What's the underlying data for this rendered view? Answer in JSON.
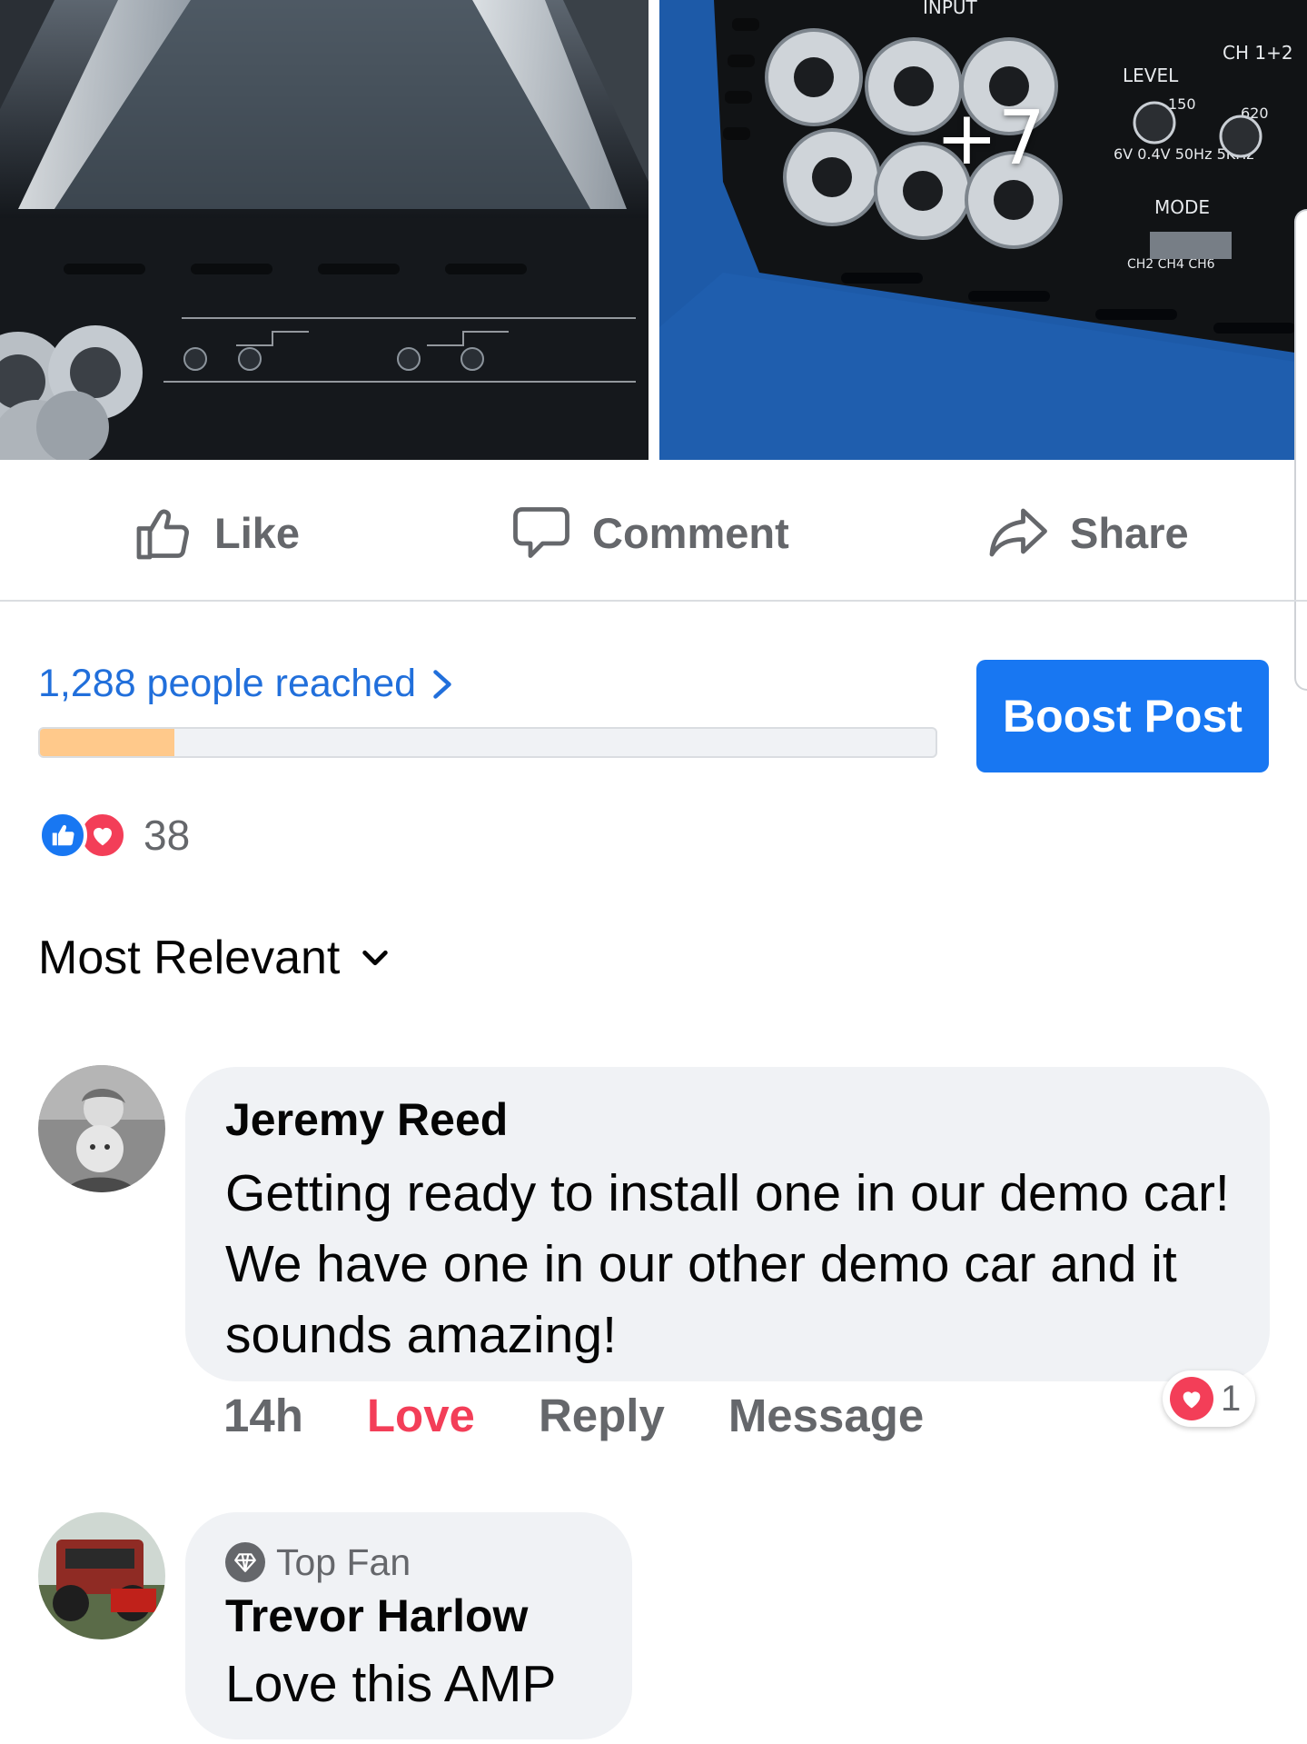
{
  "photos": {
    "more_count": "+7",
    "left_photo": "amplifier heatsink and controls",
    "right_photo": "amplifier input jacks and level controls"
  },
  "actions": {
    "like": "Like",
    "comment": "Comment",
    "share": "Share"
  },
  "insights": {
    "reach_label": "1,288 people reached",
    "reach_progress_fraction": 0.15,
    "boost_label": "Boost Post"
  },
  "reactions": {
    "count": "38",
    "types": [
      "like-icon",
      "love-icon"
    ]
  },
  "sort": {
    "label": "Most Relevant"
  },
  "comments": [
    {
      "author": "Jeremy Reed",
      "text": "Getting ready to install one in our demo car! We have one in our other demo car and it sounds amazing!",
      "time": "14h",
      "love_action": "Love",
      "reply_action": "Reply",
      "message_action": "Message",
      "reaction_count": "1"
    },
    {
      "badge": "Top Fan",
      "author": "Trevor Harlow",
      "text": "Love this AMP"
    }
  ],
  "colors": {
    "accent": "#1877f2",
    "link": "#216fdb",
    "love": "#f33e58",
    "muted": "#65676b",
    "bubble": "#f0f2f5",
    "reach_fill": "#ffc98b"
  }
}
